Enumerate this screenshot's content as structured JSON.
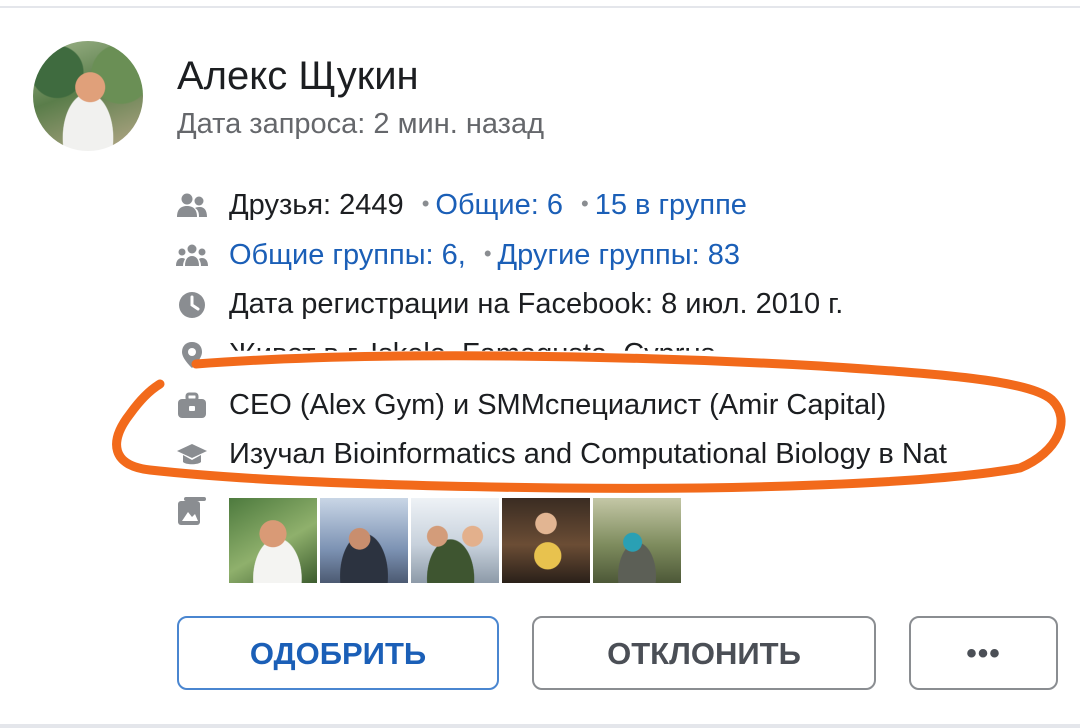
{
  "request": {
    "name": "Алекс Щукин",
    "request_date": "Дата запроса: 2 мин. назад"
  },
  "details": {
    "friends": "Друзья: 2449",
    "mutual_friends": "Общие: 6",
    "in_group": "15 в группе",
    "mutual_groups": "Общие группы: 6,",
    "other_groups": "Другие группы: 83",
    "registration": "Дата регистрации на Facebook: 8 июл. 2010 г.",
    "lives_in": "Живет в г. Iskele, Famagusta, Cyprus",
    "work": "CEO (Alex Gym) и SMMспециалист (Amir Capital)",
    "education": "Изучал Bioinformatics and Computational Biology в Nat"
  },
  "icons": {
    "friends": "people-icon",
    "groups": "groups-icon",
    "registration": "clock-icon",
    "location": "location-pin-icon",
    "work": "briefcase-icon",
    "education": "graduation-cap-icon",
    "photos": "photos-icon"
  },
  "buttons": {
    "approve": "ОДОБРИТЬ",
    "decline": "ОТКЛОНИТЬ",
    "more": "•••"
  },
  "colors": {
    "link": "#1b5fb7",
    "secondary_text": "#65676b",
    "icon": "#8a8d91",
    "annotation": "#f26a1b"
  }
}
